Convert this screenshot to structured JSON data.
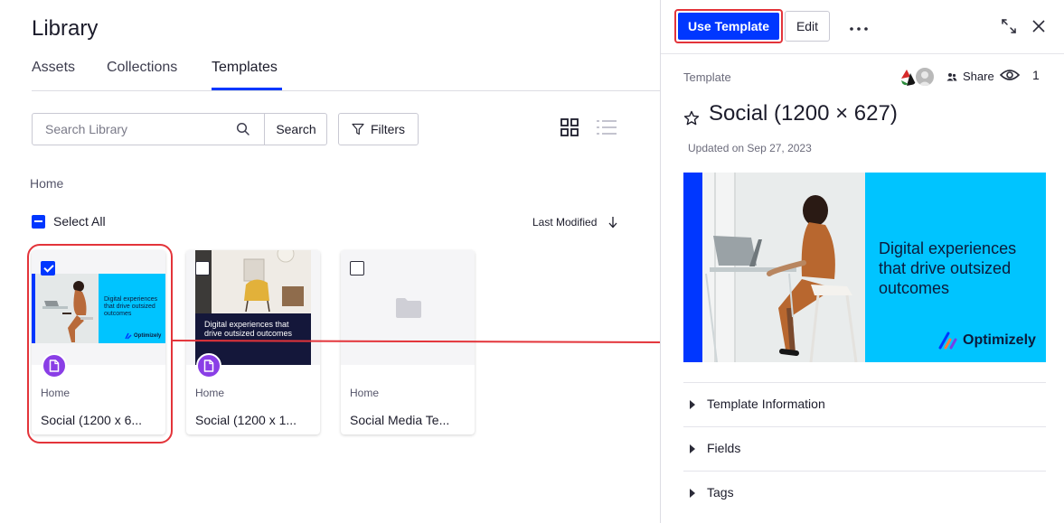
{
  "library": {
    "title": "Library",
    "tabs": [
      {
        "label": "Assets",
        "active": false
      },
      {
        "label": "Collections",
        "active": false
      },
      {
        "label": "Templates",
        "active": true
      }
    ],
    "search": {
      "placeholder": "Search Library",
      "value": "",
      "button_label": "Search"
    },
    "filters_label": "Filters",
    "view_icons": [
      "grid-view-icon",
      "list-view-icon"
    ],
    "breadcrumb": "Home",
    "select_all_label": "Select All",
    "sort_label": "Last Modified",
    "cards": [
      {
        "name": "Social (1200 x 6...",
        "location": "Home",
        "checked": true,
        "thumb_text": "Digital experiences that drive outsized outcomes",
        "thumb_logo": "Optimizely",
        "type_icon": "document-icon"
      },
      {
        "name": "Social (1200 x 1...",
        "location": "Home",
        "checked": false,
        "thumb_text": "Digital experiences that drive outsized outcomes",
        "type_icon": "document-icon"
      },
      {
        "name": "Social Media Te...",
        "location": "Home",
        "checked": false,
        "type_icon": "folder-icon"
      }
    ]
  },
  "panel": {
    "primary_action": "Use Template",
    "edit_label": "Edit",
    "type_label": "Template",
    "share_label": "Share",
    "view_count": "1",
    "title": "Social (1200 × 627)",
    "updated": "Updated on Sep 27, 2023",
    "preview": {
      "text": "Digital experiences that drive outsized outcomes",
      "logo": "Optimizely"
    },
    "sections": [
      "Template Information",
      "Fields",
      "Tags"
    ]
  },
  "colors": {
    "accent": "#0037ff",
    "highlight": "#e3343a",
    "brand_cyan": "#00c4ff",
    "badge_purple": "#8a3ee6"
  }
}
